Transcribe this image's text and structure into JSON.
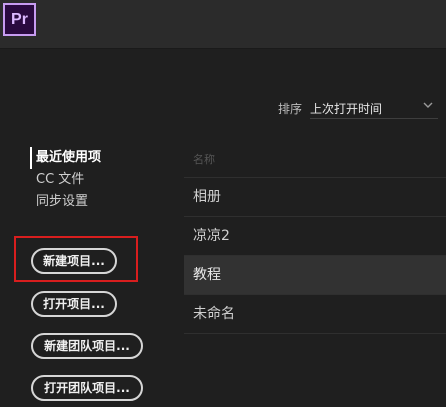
{
  "app": {
    "logo_text": "Pr"
  },
  "sort": {
    "label": "排序",
    "value": "上次打开时间"
  },
  "nav": {
    "items": [
      {
        "label": "最近使用项"
      },
      {
        "label": "CC 文件"
      },
      {
        "label": "同步设置"
      }
    ]
  },
  "buttons": {
    "new_project": "新建项目...",
    "open_project": "打开项目...",
    "new_team_project": "新建团队项目...",
    "open_team_project": "打开团队项目..."
  },
  "list": {
    "header": "名称",
    "items": [
      {
        "name": "相册"
      },
      {
        "name": "凉凉2"
      },
      {
        "name": "教程"
      },
      {
        "name": "未命名"
      }
    ]
  },
  "colors": {
    "logo_border": "#c79cf0",
    "logo_bg": "#2a0a3f",
    "highlight": "#d81e1e"
  },
  "icons": {
    "sort_dropdown": "chevron-down-icon",
    "logo": "premiere-pro-logo"
  }
}
